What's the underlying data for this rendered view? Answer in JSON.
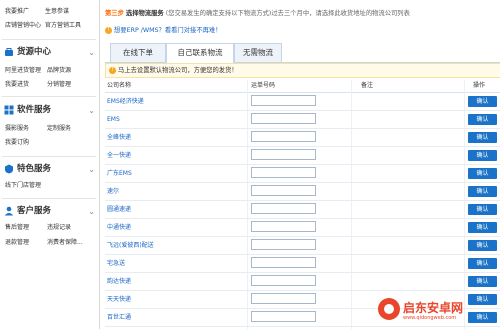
{
  "sidebar": {
    "top_links": [
      "我要推广",
      "生意参谋",
      "店铺营销中心",
      "官方营销工具"
    ],
    "sections": [
      {
        "title": "货源中心",
        "links": [
          "阿里进货管理",
          "品牌货源",
          "我要进货",
          "分销管理"
        ]
      },
      {
        "title": "软件服务",
        "links": [
          "摄影服务",
          "定制服务",
          "我要订购"
        ]
      },
      {
        "title": "特色服务",
        "links": [
          "线下门店管理"
        ]
      },
      {
        "title": "客户服务",
        "links": [
          "售后管理",
          "违规记录",
          "退款管理",
          "消费者保障..."
        ]
      }
    ]
  },
  "step": {
    "number": "第三步",
    "title": "选择物流服务",
    "desc": "(您交易发生的确定支持以下物流方式)过去三个月中，请选择此收货地址的物流公司列表"
  },
  "warning": {
    "text": "想要ERP /WMS？看看门对接不再难！"
  },
  "tabs": [
    "在线下单",
    "自己联系物流",
    "无需物流"
  ],
  "active_tab": 1,
  "notice": {
    "text": "马上去设置默认物流公司，方便您的发货！"
  },
  "table": {
    "headers": [
      "公司名称",
      "运单号码",
      "备注",
      "操作"
    ],
    "rows": [
      {
        "name": "EMS经济快递",
        "action": "确认"
      },
      {
        "name": "EMS",
        "action": "确认"
      },
      {
        "name": "全峰快递",
        "action": "确认"
      },
      {
        "name": "全一快递",
        "action": "确认"
      },
      {
        "name": "广东EMS",
        "action": "确认"
      },
      {
        "name": "速尔",
        "action": "确认"
      },
      {
        "name": "圆通速递",
        "action": "确认"
      },
      {
        "name": "中通快递",
        "action": "确认"
      },
      {
        "name": "飞远(爱彼西)配送",
        "action": "确认"
      },
      {
        "name": "宅急送",
        "action": "确认"
      },
      {
        "name": "韵达快递",
        "action": "确认"
      },
      {
        "name": "天天快递",
        "action": "确认"
      },
      {
        "name": "百世汇通",
        "action": "确认"
      }
    ]
  },
  "watermark": {
    "title": "启东安卓网",
    "url": "www.qidongweb.com"
  },
  "colors": {
    "accent": "#1a73c8",
    "step": "#ff6600",
    "link": "#1a66c4"
  }
}
